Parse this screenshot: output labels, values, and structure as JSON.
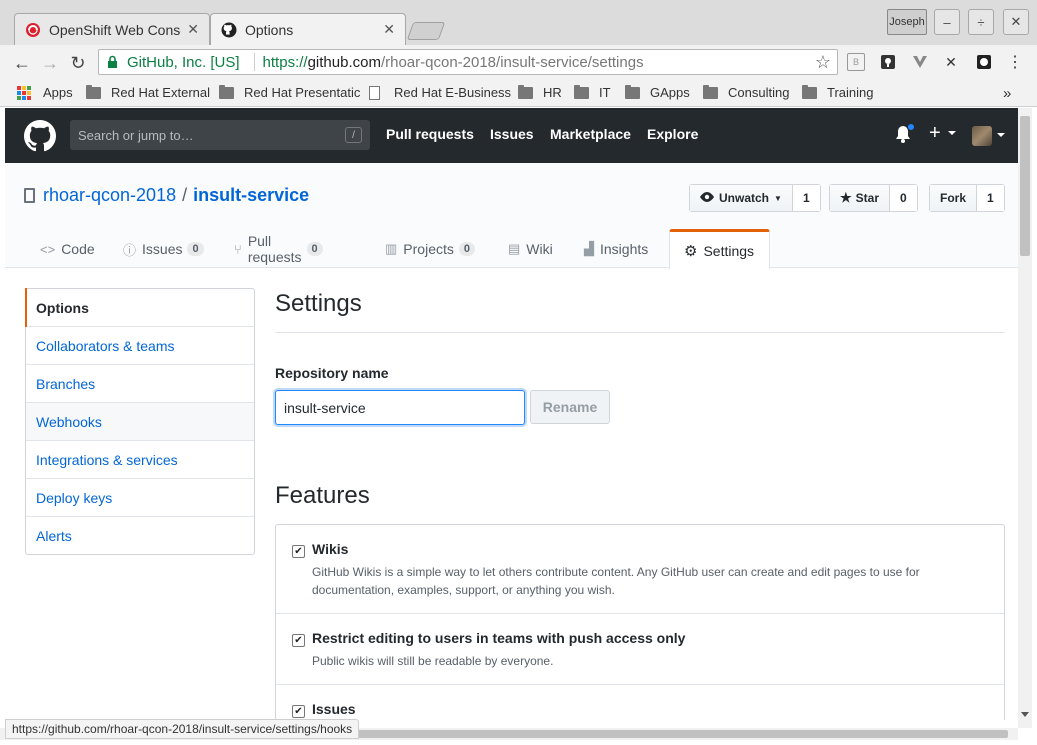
{
  "browser": {
    "tabs": [
      {
        "title": "OpenShift Web Console",
        "favicon": "openshift-icon"
      },
      {
        "title": "Options",
        "favicon": "github-icon"
      }
    ],
    "profile_name": "Joseph",
    "window_buttons": {
      "minimize": "–",
      "maximize": "÷",
      "close": "✕"
    },
    "omnibox": {
      "ev_label": "GitHub, Inc. [US]",
      "scheme": "https://",
      "host": "github.com",
      "path": "/rhoar-qcon-2018/insult-service/settings"
    },
    "bookmarks": [
      {
        "label": "Apps",
        "type": "apps"
      },
      {
        "label": "Red Hat External",
        "type": "folder"
      },
      {
        "label": "Red Hat Presentatic",
        "type": "folder"
      },
      {
        "label": "Red Hat E-Business",
        "type": "page"
      },
      {
        "label": "HR",
        "type": "folder"
      },
      {
        "label": "IT",
        "type": "folder"
      },
      {
        "label": "GApps",
        "type": "folder"
      },
      {
        "label": "Consulting",
        "type": "folder"
      },
      {
        "label": "Training",
        "type": "folder"
      }
    ],
    "bookmarks_overflow": "»",
    "status_url": "https://github.com/rhoar-qcon-2018/insult-service/settings/hooks"
  },
  "github": {
    "search_placeholder": "Search or jump to…",
    "search_shortcut": "/",
    "nav": [
      "Pull requests",
      "Issues",
      "Marketplace",
      "Explore"
    ],
    "plus": "+"
  },
  "repo": {
    "owner": "rhoar-qcon-2018",
    "separator": "/",
    "name": "insult-service",
    "watch": {
      "label": "Unwatch",
      "count": "1"
    },
    "star": {
      "label": "Star",
      "count": "0"
    },
    "fork": {
      "label": "Fork",
      "count": "1"
    },
    "tabs": [
      {
        "label": "Code",
        "icon": "code-icon",
        "glyph": "<>"
      },
      {
        "label": "Issues",
        "icon": "issue-icon",
        "glyph": "ⓘ",
        "count": "0"
      },
      {
        "label": "Pull requests",
        "icon": "pull-request-icon",
        "glyph": "⑂",
        "count": "0"
      },
      {
        "label": "Projects",
        "icon": "project-icon",
        "glyph": "▥",
        "count": "0"
      },
      {
        "label": "Wiki",
        "icon": "book-icon",
        "glyph": "▤"
      },
      {
        "label": "Insights",
        "icon": "graph-icon",
        "glyph": "▟"
      },
      {
        "label": "Settings",
        "icon": "gear-icon",
        "glyph": "⚙"
      }
    ]
  },
  "menu": [
    "Options",
    "Collaborators & teams",
    "Branches",
    "Webhooks",
    "Integrations & services",
    "Deploy keys",
    "Alerts"
  ],
  "settings": {
    "title": "Settings",
    "repo_name_label": "Repository name",
    "repo_name_value": "insult-service",
    "rename_label": "Rename",
    "features_title": "Features",
    "features": [
      {
        "title": "Wikis",
        "checked": true,
        "description": "GitHub Wikis is a simple way to let others contribute content. Any GitHub user can create and edit pages to use for documentation, examples, support, or anything you wish."
      },
      {
        "title": "Restrict editing to users in teams with push access only",
        "checked": true,
        "description": "Public wikis will still be readable by everyone."
      },
      {
        "title": "Issues",
        "checked": true,
        "description": ""
      }
    ]
  },
  "colors": {
    "accent": "#e36209",
    "link": "#0366d6",
    "header_bg": "#24292e",
    "secure_green": "#0b8043"
  }
}
